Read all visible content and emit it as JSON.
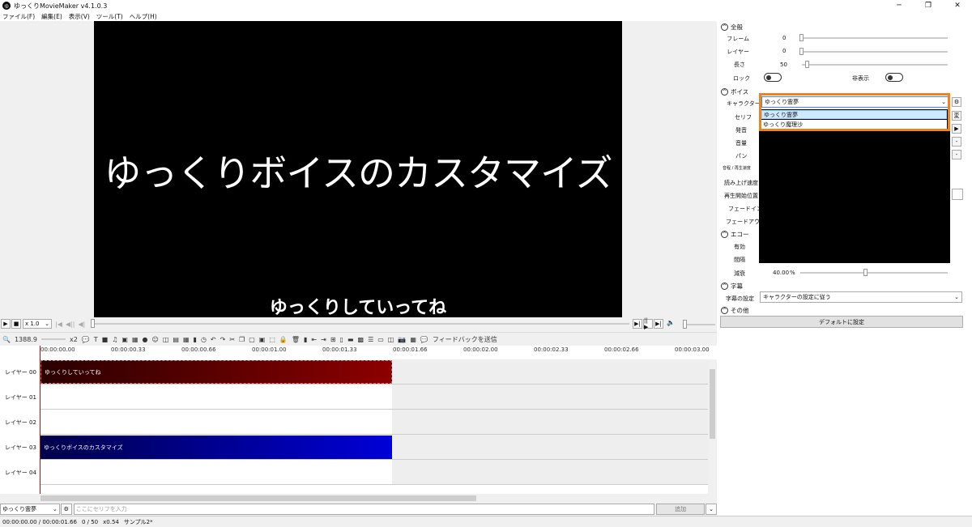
{
  "window": {
    "title": "ゆっくりMovieMaker v4.1.0.3",
    "app_icon": "ゆ",
    "minimize": "─",
    "maximize": "❐",
    "close": "✕"
  },
  "menu": [
    "ファイル(F)",
    "編集(E)",
    "表示(V)",
    "ツール(T)",
    "ヘルプ(H)"
  ],
  "preview": {
    "main_text": "ゆっくりボイスのカスタマイズ",
    "sub_text": "ゆっくりしていってね"
  },
  "playback": {
    "speed": "x 1.0"
  },
  "toolbar": {
    "zoom": "1388.9",
    "zoom_multiplier": "x2",
    "feedback_label": "フィードバックを送信"
  },
  "timeline": {
    "ticks": [
      "00:00:00.00",
      "00:00:00.33",
      "00:00:00.66",
      "00:00:01.00",
      "00:00:01.33",
      "00:00:01.66",
      "00:00:02.00",
      "00:00:02.33",
      "00:00:02.66",
      "00:00:03.00"
    ],
    "layers": [
      {
        "label": "レイヤー 00",
        "clip": "ゆっくりしていってね",
        "color": "#8c0000"
      },
      {
        "label": "レイヤー 01",
        "clip": ""
      },
      {
        "label": "レイヤー 02",
        "clip": ""
      },
      {
        "label": "レイヤー 03",
        "clip": "ゆっくりボイスのカスタマイズ",
        "color": "#0000d8"
      },
      {
        "label": "レイヤー 04",
        "clip": ""
      }
    ]
  },
  "input_bar": {
    "character": "ゆっくり霊夢",
    "placeholder": "ここにセリフを入力",
    "add_label": "追加"
  },
  "status": {
    "time": "00:00:00.00 / 00:00:01.66",
    "frame": "0 / 50",
    "zoom": "x0.54",
    "project": "サンプル2*"
  },
  "properties": {
    "general": {
      "title": "全般",
      "frame_label": "フレーム",
      "frame_value": "0",
      "layer_label": "レイヤー",
      "layer_value": "0",
      "length_label": "長さ",
      "length_value": "50",
      "lock_label": "ロック",
      "hide_label": "非表示"
    },
    "voice": {
      "title": "ボイス",
      "character_label": "キャラクター",
      "character_value": "ゆっくり霊夢",
      "options": [
        "ゆっくり霊夢",
        "ゆっくり魔理沙"
      ],
      "serif_label": "セリフ",
      "pronunciation_label": "発音",
      "volume_label": "音量",
      "pan_label": "パン",
      "play_speed_label": "音程 / 再生速度",
      "read_speed_label": "読み上げ速度",
      "start_pos_label": "再生開始位置",
      "fadein_label": "フェードイン",
      "fadeout_label": "フェードアウト",
      "edit_btn": "変"
    },
    "echo": {
      "title": "エコー",
      "enabled_label": "有効",
      "interval_label": "間隔",
      "decay_label": "減衰",
      "decay_value": "40.00",
      "decay_unit": "%"
    },
    "subtitle": {
      "title": "字幕",
      "setting_label": "字幕の設定",
      "setting_value": "キャラクターの設定に従う"
    },
    "other": {
      "title": "その他"
    },
    "default_button": "デフォルトに設定"
  }
}
